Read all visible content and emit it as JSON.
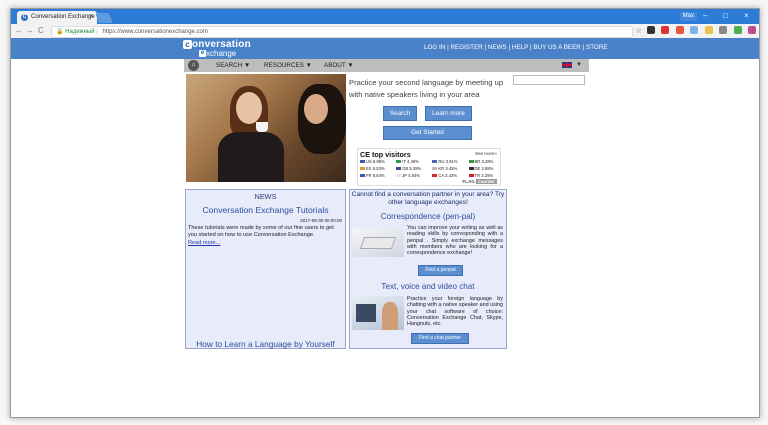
{
  "browser": {
    "tab_title": "Conversation Exchange",
    "tab_close": "×",
    "user_label": "Max",
    "minimize": "–",
    "maximize": "□",
    "close": "×",
    "secure_label": "Надежный",
    "url": "https://www.conversationexchange.com",
    "back": "←",
    "forward": "→",
    "reload": "C",
    "star": "☆",
    "menu": "⋮"
  },
  "header": {
    "logo_line1": "onversation",
    "logo_line2": "xchange",
    "logo_c": "c",
    "logo_e": "e",
    "links": [
      "LOG IN",
      "REGISTER",
      "NEWS",
      "HELP",
      "BUY US A BEER",
      "STORE"
    ],
    "separator": " | "
  },
  "menubar": {
    "home_icon": "⌂",
    "items": [
      "SEARCH",
      "RESOURCES",
      "ABOUT"
    ],
    "arrow": "▼"
  },
  "hero": {
    "tagline": "Practice your second language by meeting up with native speakers living in your area",
    "search_label": "Search",
    "learn_more_label": "Learn more",
    "get_started_label": "Get Started"
  },
  "top_visitors": {
    "title": "CE top visitors",
    "see_more": "See more»",
    "rows": [
      [
        {
          "code": "US",
          "pct": "8.95%"
        },
        {
          "code": "IT",
          "pct": "4.46%"
        },
        {
          "code": "RU",
          "pct": "3.91%"
        },
        {
          "code": "BR",
          "pct": "3.28%"
        }
      ],
      [
        {
          "code": "ES",
          "pct": "6.53%"
        },
        {
          "code": "GB",
          "pct": "5.39%"
        },
        {
          "code": "KR",
          "pct": "3.45%"
        },
        {
          "code": "DE",
          "pct": "2.88%"
        }
      ],
      [
        {
          "code": "FR",
          "pct": "6.64%"
        },
        {
          "code": "JP",
          "pct": "4.84%"
        },
        {
          "code": "CA",
          "pct": "3.43%"
        },
        {
          "code": "TR",
          "pct": "2.25%"
        }
      ]
    ],
    "counter_label": "FLAG",
    "counter_suffix": "counter"
  },
  "news": {
    "heading": "NEWS",
    "title": "Conversation Exchange Tutorials",
    "date": "2017-08-30 00:00:00",
    "description": "These tutorials were made by some of our fine users to get you started on how to use Conversation Exchange.",
    "read_more": "Read more...",
    "footer_title": "How to Learn a Language by Yourself"
  },
  "penpal": {
    "cta": "Cannot find a conversation partner in your area? Try other language exchanges!",
    "correspondence_title": "Correspondence (pen-pal)",
    "correspondence_text": "You can improve your writing as well as reading skills by corresponding with a penpal . Simply exchange messages with members who are looking for a correspondence exchange!",
    "find_penpal": "Find a penpal",
    "chat_title": "Text, voice and video chat",
    "chat_text": "Practice your foreign language by chatting with a native speaker and using your chat software of choice: Conversation Exchange Chat, Skype, Hangouts, etc.",
    "find_chat": "Find a chat partner"
  },
  "colors": {
    "brand_blue": "#4a82c9",
    "chrome_blue": "#2c7bd6",
    "panel_bg": "#e7ebfa",
    "button_blue": "#5b8fd0"
  }
}
